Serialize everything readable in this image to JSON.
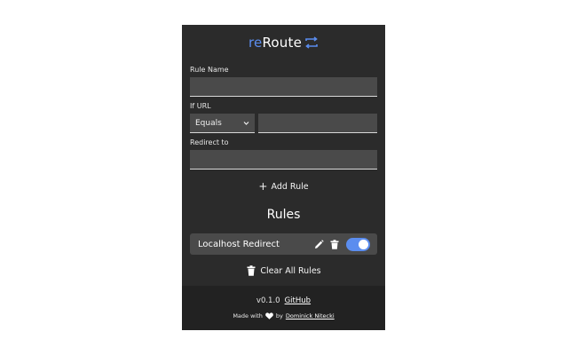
{
  "app": {
    "logo_re": "re",
    "logo_route": "Route",
    "logo_icon": "swap-arrows-icon",
    "accent_color": "#5b8def"
  },
  "form": {
    "rule_name_label": "Rule Name",
    "rule_name_value": "",
    "if_url_label": "If URL",
    "match_type_selected": "Equals",
    "url_value": "",
    "redirect_label": "Redirect to",
    "redirect_value": "",
    "add_rule_plus": "+",
    "add_rule_label": "Add Rule"
  },
  "rules": {
    "heading": "Rules",
    "items": [
      {
        "name": "Localhost Redirect",
        "enabled": true,
        "edit_icon": "pencil-icon",
        "delete_icon": "trash-icon"
      }
    ],
    "clear_all_label": "Clear All Rules",
    "clear_all_icon": "trash-icon"
  },
  "footer": {
    "version": "v0.1.0",
    "github_label": "GitHub",
    "made_with": "Made with",
    "heart_icon": "heart-icon",
    "by": "by",
    "author": "Dominick Nitecki"
  }
}
